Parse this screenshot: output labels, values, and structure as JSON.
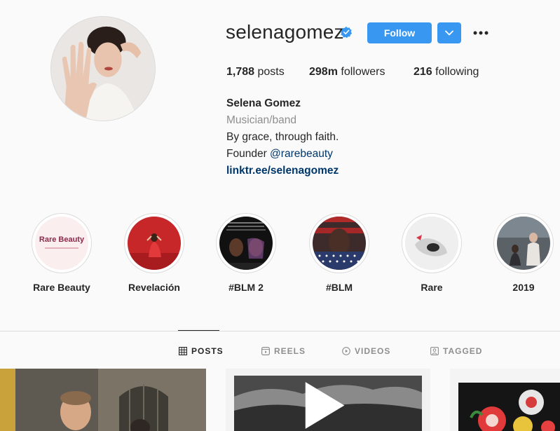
{
  "profile": {
    "username": "selenagomez",
    "verified": true,
    "follow_label": "Follow",
    "stats": {
      "posts_count": "1,788",
      "posts_label": " posts",
      "followers_count": "298m",
      "followers_label": " followers",
      "following_count": "216",
      "following_label": " following"
    },
    "bio": {
      "name": "Selena Gomez",
      "category": "Musician/band",
      "line1": "By grace, through faith.",
      "founder_prefix": "Founder ",
      "founder_mention": "@rarebeauty",
      "link": "linktr.ee/selenagomez"
    }
  },
  "highlights": [
    {
      "label": "Rare Beauty",
      "badge_text": "Rare Beauty"
    },
    {
      "label": "Revelación"
    },
    {
      "label": "#BLM 2"
    },
    {
      "label": "#BLM"
    },
    {
      "label": "Rare"
    },
    {
      "label": "2019"
    }
  ],
  "tabs": [
    {
      "label": "POSTS",
      "icon": "grid-icon",
      "active": true
    },
    {
      "label": "REELS",
      "icon": "reels-icon",
      "active": false
    },
    {
      "label": "VIDEOS",
      "icon": "play-circle-icon",
      "active": false
    },
    {
      "label": "TAGGED",
      "icon": "tag-person-icon",
      "active": false
    }
  ],
  "colors": {
    "accent_blue": "#3897f0",
    "verified_blue": "#3897f0",
    "link_blue": "#00376b",
    "muted_gray": "#8e8e8e",
    "text": "#262626",
    "background": "#fafafa"
  }
}
